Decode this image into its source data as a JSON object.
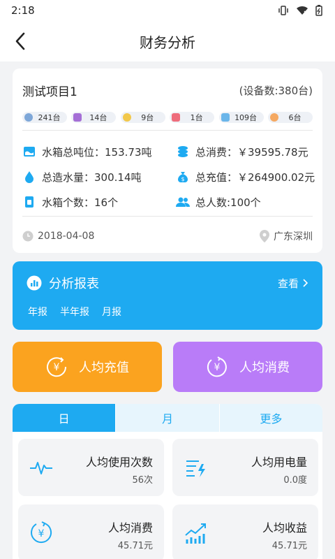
{
  "status_bar": {
    "time": "2:18"
  },
  "header": {
    "title": "财务分析"
  },
  "project": {
    "name": "测试项目1",
    "device_count": "(设备数:380台)",
    "chips": [
      {
        "icon": "pill-icon",
        "value": "241台"
      },
      {
        "icon": "camera-icon",
        "value": "14台"
      },
      {
        "icon": "key-icon",
        "value": "9台"
      },
      {
        "icon": "phone-icon",
        "value": "1台"
      },
      {
        "icon": "card-icon",
        "value": "109台"
      },
      {
        "icon": "more-icon",
        "value": "6台"
      }
    ],
    "stats": [
      {
        "label": "水箱总吨位：153.73吨",
        "icon": "water-tank-icon"
      },
      {
        "label": "总消费：￥39595.78元",
        "icon": "coins-icon"
      },
      {
        "label": "总造水量：300.14吨",
        "icon": "water-drop-icon"
      },
      {
        "label": "总充值：￥264900.02元",
        "icon": "money-bag-icon"
      },
      {
        "label": "水箱个数：16个",
        "icon": "tank-count-icon"
      },
      {
        "label": "总人数:100个",
        "icon": "users-icon"
      }
    ],
    "date": "2018-04-08",
    "location": "广东深圳"
  },
  "report": {
    "title": "分析报表",
    "view_label": "查看",
    "tabs": [
      "年报",
      "半年报",
      "月报"
    ]
  },
  "buttons": {
    "recharge": "人均充值",
    "consume": "人均消费"
  },
  "period_tabs": [
    "日",
    "月",
    "更多"
  ],
  "tiles": [
    {
      "label": "人均使用次数",
      "value": "56次",
      "icon": "pulse-icon"
    },
    {
      "label": "人均用电量",
      "value": "0.0度",
      "icon": "power-icon"
    },
    {
      "label": "人均消费",
      "value": "45.71元",
      "icon": "yen-circle-icon"
    },
    {
      "label": "人均收益",
      "value": "45.71元",
      "icon": "growth-chart-icon"
    }
  ],
  "colors": {
    "accent": "#1eaaf1",
    "orange": "#fba31f",
    "purple": "#b97cf8"
  }
}
